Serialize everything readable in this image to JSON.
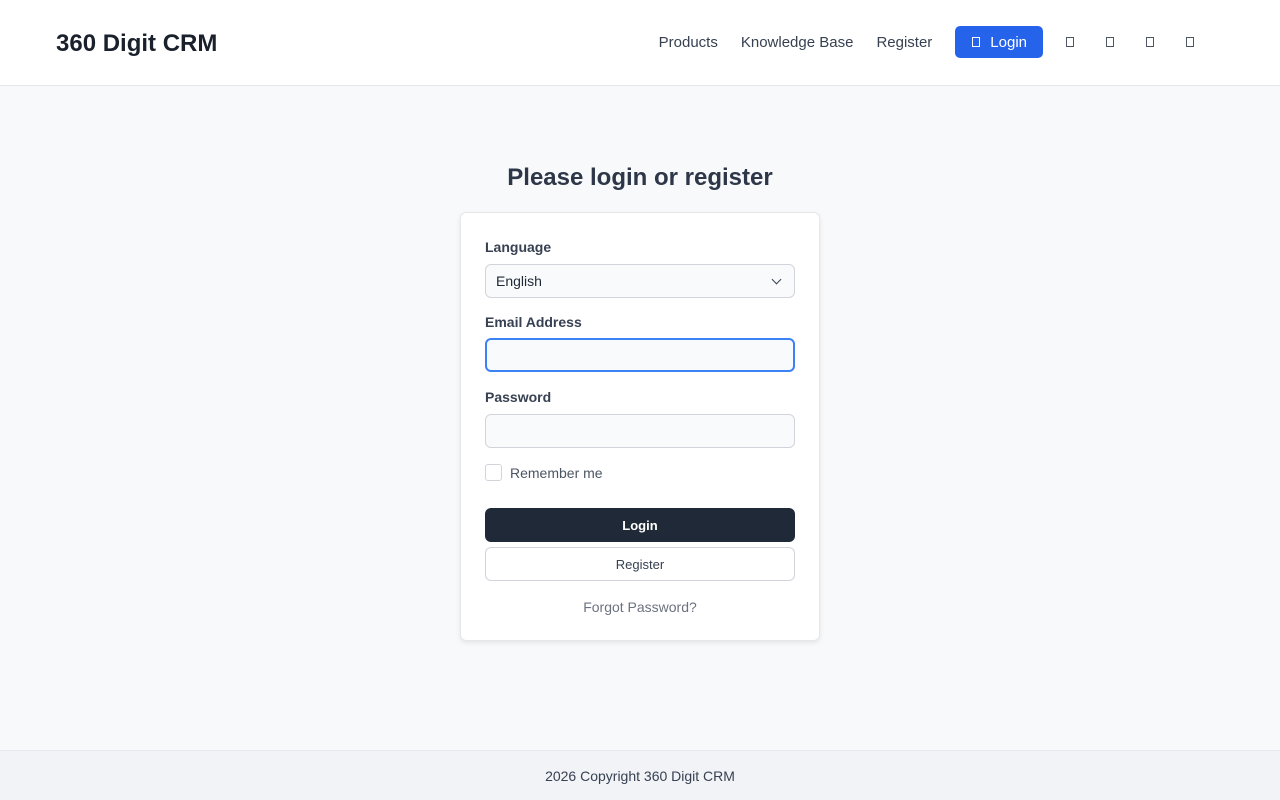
{
  "brand": "360 Digit CRM",
  "nav": {
    "products": "Products",
    "knowledge_base": "Knowledge Base",
    "register": "Register",
    "login": "Login",
    "icons": [
      "facebook-icon",
      "twitter-icon",
      "linkedin-icon",
      "youtube-icon"
    ]
  },
  "main": {
    "title": "Please login or register",
    "language_label": "Language",
    "language_value": "English",
    "email_label": "Email Address",
    "email_value": "",
    "password_label": "Password",
    "password_value": "",
    "remember_label": "Remember me",
    "login_button": "Login",
    "register_button": "Register",
    "forgot_link": "Forgot Password?"
  },
  "footer": {
    "copyright": "2026 Copyright 360 Digit CRM"
  },
  "colors": {
    "accent": "#2563eb",
    "primary_button": "#1f2937",
    "focus": "#3b82f6"
  }
}
